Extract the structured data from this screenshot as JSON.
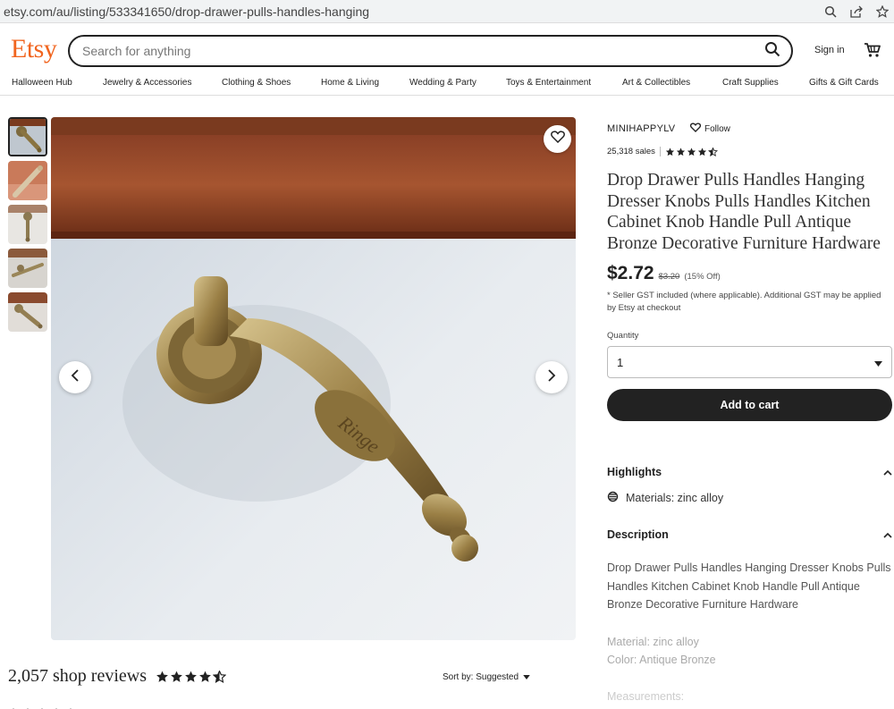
{
  "browser": {
    "url": "etsy.com/au/listing/533341650/drop-drawer-pulls-handles-hanging",
    "icons": [
      "zoom-icon",
      "share-icon",
      "bookmark-star-icon"
    ]
  },
  "header": {
    "logo": "Etsy",
    "search_placeholder": "Search for anything",
    "sign_in": "Sign in",
    "brand_color": "#f1641e"
  },
  "nav": [
    "Halloween Hub",
    "Jewelry & Accessories",
    "Clothing & Shoes",
    "Home & Living",
    "Wedding & Party",
    "Toys & Entertainment",
    "Art & Collectibles",
    "Craft Supplies",
    "Gifts & Gift Cards"
  ],
  "gallery": {
    "thumbnail_count": 5,
    "selected_index": 0
  },
  "shop": {
    "name": "MINIHAPPYLV",
    "follow": "Follow",
    "sales": "25,318 sales",
    "rating": 4.5
  },
  "listing": {
    "title": "Drop Drawer Pulls Handles Hanging Dresser Knobs Pulls Handles Kitchen Cabinet Knob Handle Pull Antique Bronze Decorative Furniture Hardware",
    "price": "$2.72",
    "original_price": "$3.20",
    "discount": "(15% Off)",
    "gst_note": "* Seller GST included (where applicable). Additional GST may be applied by Etsy at checkout",
    "quantity_label": "Quantity",
    "quantity_value": "1",
    "add_to_cart": "Add to cart"
  },
  "highlights": {
    "heading": "Highlights",
    "materials": "Materials: zinc alloy"
  },
  "description": {
    "heading": "Description",
    "text": "Drop Drawer Pulls Handles Hanging Dresser Knobs Pulls Handles Kitchen Cabinet Knob Handle Pull Antique Bronze Decorative Furniture Hardware",
    "material": "Material: zinc alloy",
    "color": "Color: Antique Bronze",
    "measurements": "Measurements:"
  },
  "reviews": {
    "count": "2,057 shop reviews",
    "rating": 4.5,
    "sort_by": "Sort by: Suggested"
  }
}
